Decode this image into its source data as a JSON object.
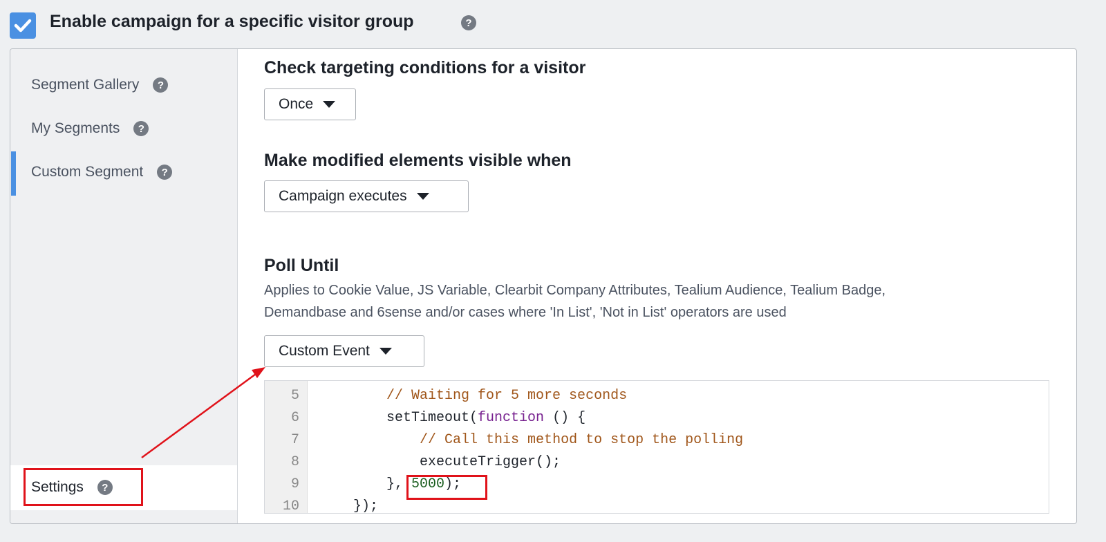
{
  "header": {
    "title": "Enable campaign for a specific visitor group",
    "checked": true
  },
  "sidebar": {
    "items": [
      {
        "label": "Segment Gallery"
      },
      {
        "label": "My Segments"
      },
      {
        "label": "Custom Segment",
        "active": true
      }
    ],
    "settings_label": "Settings"
  },
  "main": {
    "check_heading": "Check targeting conditions for a visitor",
    "check_value": "Once",
    "visible_heading": "Make modified elements visible when",
    "visible_value": "Campaign executes",
    "poll_heading": "Poll Until",
    "poll_desc_1": "Applies to Cookie Value, JS Variable, Clearbit Company Attributes, Tealium Audience, Tealium Badge,",
    "poll_desc_2": "Demandbase and 6sense and/or cases where 'In List', 'Not in List' operators are used",
    "poll_value": "Custom Event"
  },
  "code": {
    "lines": [
      {
        "n": "5",
        "parts": [
          {
            "t": "        "
          },
          {
            "t": "// Waiting for 5 more seconds",
            "c": "cm"
          }
        ]
      },
      {
        "n": "6",
        "parts": [
          {
            "t": "        setTimeout("
          },
          {
            "t": "function",
            "c": "kw"
          },
          {
            "t": " () {"
          }
        ]
      },
      {
        "n": "7",
        "parts": [
          {
            "t": "            "
          },
          {
            "t": "// Call this method to stop the polling",
            "c": "cm"
          }
        ]
      },
      {
        "n": "8",
        "parts": [
          {
            "t": "            executeTrigger();"
          }
        ]
      },
      {
        "n": "9",
        "parts": [
          {
            "t": "        }, "
          },
          {
            "t": "5000",
            "c": "num"
          },
          {
            "t": ");"
          }
        ]
      },
      {
        "n": "10",
        "parts": [
          {
            "t": "    });"
          }
        ]
      }
    ]
  },
  "colors": {
    "accent": "#4a90e2",
    "highlight": "#e0121a"
  }
}
